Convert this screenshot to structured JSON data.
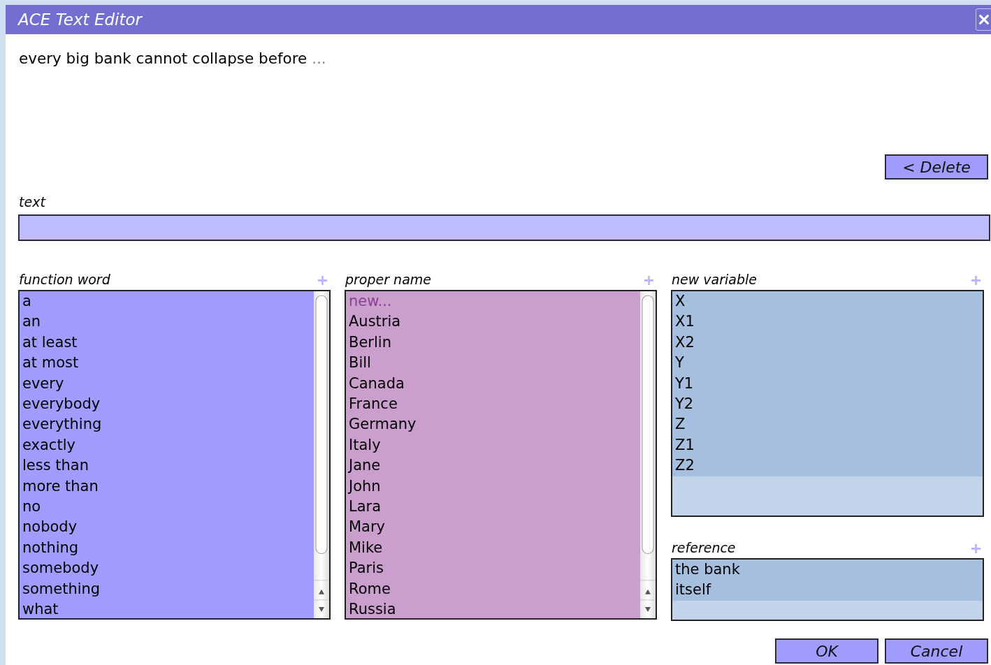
{
  "window": {
    "title": "ACE Text Editor"
  },
  "sentence": {
    "text": "every big bank cannot collapse before",
    "continuation": "..."
  },
  "delete_button": "< Delete",
  "text_field": {
    "label": "text"
  },
  "panels": [
    {
      "title": "function word",
      "color": "#a09dff",
      "scrollable": true,
      "items": [
        {
          "label": "a",
          "kind": "word"
        },
        {
          "label": "an",
          "kind": "word"
        },
        {
          "label": "at least",
          "kind": "word"
        },
        {
          "label": "at most",
          "kind": "word"
        },
        {
          "label": "every",
          "kind": "word"
        },
        {
          "label": "everybody",
          "kind": "word"
        },
        {
          "label": "everything",
          "kind": "word"
        },
        {
          "label": "exactly",
          "kind": "word"
        },
        {
          "label": "less than",
          "kind": "word"
        },
        {
          "label": "more than",
          "kind": "word"
        },
        {
          "label": "no",
          "kind": "word"
        },
        {
          "label": "nobody",
          "kind": "word"
        },
        {
          "label": "nothing",
          "kind": "word"
        },
        {
          "label": "somebody",
          "kind": "word"
        },
        {
          "label": "something",
          "kind": "word"
        },
        {
          "label": "what",
          "kind": "word"
        }
      ]
    },
    {
      "title": "proper name",
      "color": "#cb9fcd",
      "scrollable": true,
      "items": [
        {
          "label": "new...",
          "kind": "new"
        },
        {
          "label": "Austria",
          "kind": "word"
        },
        {
          "label": "Berlin",
          "kind": "word"
        },
        {
          "label": "Bill",
          "kind": "word"
        },
        {
          "label": "Canada",
          "kind": "word"
        },
        {
          "label": "France",
          "kind": "word"
        },
        {
          "label": "Germany",
          "kind": "word"
        },
        {
          "label": "Italy",
          "kind": "word"
        },
        {
          "label": "Jane",
          "kind": "word"
        },
        {
          "label": "John",
          "kind": "word"
        },
        {
          "label": "Lara",
          "kind": "word"
        },
        {
          "label": "Mary",
          "kind": "word"
        },
        {
          "label": "Mike",
          "kind": "word"
        },
        {
          "label": "Paris",
          "kind": "word"
        },
        {
          "label": "Rome",
          "kind": "word"
        },
        {
          "label": "Russia",
          "kind": "word"
        }
      ]
    },
    {
      "title": "new variable",
      "color": "#a6bfdf",
      "scrollable": false,
      "items": [
        {
          "label": "X",
          "kind": "word"
        },
        {
          "label": "X1",
          "kind": "word"
        },
        {
          "label": "X2",
          "kind": "word"
        },
        {
          "label": "Y",
          "kind": "word"
        },
        {
          "label": "Y1",
          "kind": "word"
        },
        {
          "label": "Y2",
          "kind": "word"
        },
        {
          "label": "Z",
          "kind": "word"
        },
        {
          "label": "Z1",
          "kind": "word"
        },
        {
          "label": "Z2",
          "kind": "word"
        }
      ]
    },
    {
      "title": "reference",
      "color": "#a6bfdf",
      "scrollable": false,
      "items": [
        {
          "label": "the bank",
          "kind": "word"
        },
        {
          "label": "itself",
          "kind": "word"
        }
      ]
    }
  ],
  "buttons": [
    "OK",
    "Cancel"
  ]
}
